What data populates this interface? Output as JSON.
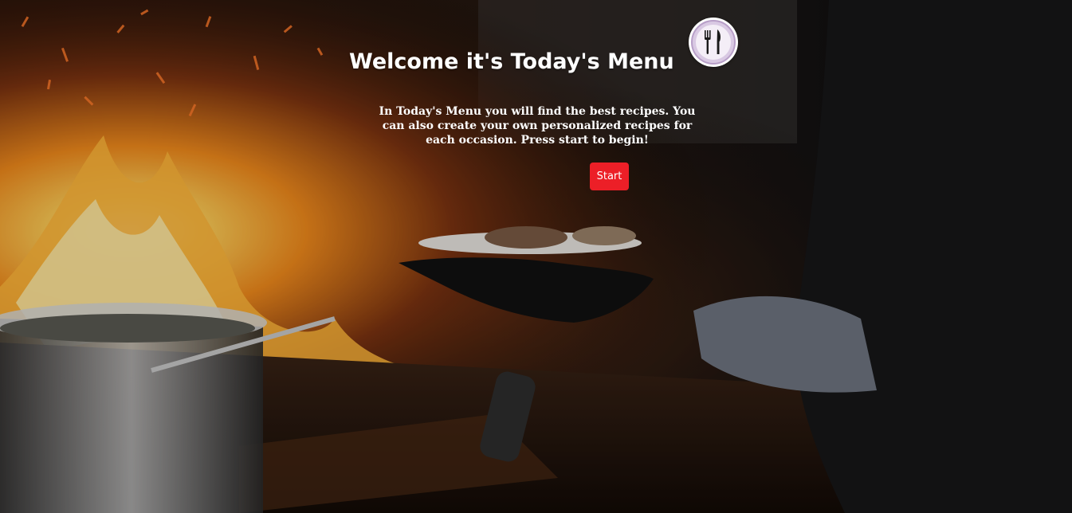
{
  "hero": {
    "title": "Welcome it's Today's Menu",
    "intro": "In Today's Menu you will find the best recipes. You can also create your own personalized recipes for each occasion. Press start to begin!",
    "start_label": "Start"
  },
  "logo": {
    "icon": "fork-knife-icon"
  },
  "background": {
    "icon": "kitchen-fire-photo"
  },
  "colors": {
    "accent": "#ec1f27",
    "text": "#ffffff",
    "logo_ring": "#b89fc8"
  }
}
